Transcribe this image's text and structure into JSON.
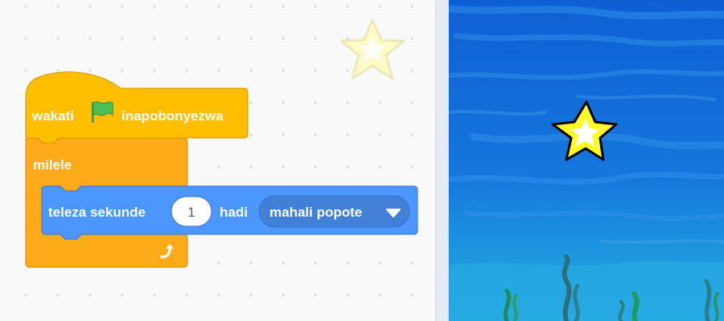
{
  "code_area": {
    "hat_block": {
      "before_flag": "wakati",
      "flag_icon": "green-flag-icon",
      "after_flag": "inapobonyezwa",
      "color": "#ffbf00"
    },
    "forever_block": {
      "label": "milele",
      "loop_icon": "loop-arrow-icon",
      "color": "#ffab19"
    },
    "glide_block": {
      "label_start": "teleza sekunde",
      "seconds_value": "1",
      "label_mid": "hadi",
      "dropdown_value": "mahali popote",
      "dropdown_icon": "caret-down-icon",
      "color": "#4c97ff"
    },
    "sprite_thumbnail": "star-sprite-icon"
  },
  "stage": {
    "backdrop": "underwater",
    "sprite": "star-sprite",
    "colors": {
      "water_top": "#0f5fd4",
      "water_bottom": "#22a6e0",
      "star": "#ffff20"
    }
  }
}
